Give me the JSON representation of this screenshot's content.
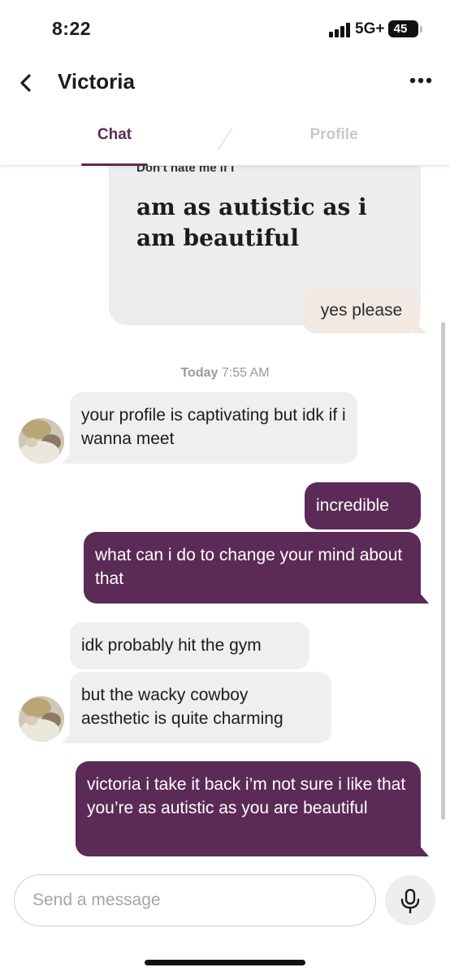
{
  "status_bar": {
    "time": "8:22",
    "network": "5G+",
    "battery": "45"
  },
  "header": {
    "title": "Victoria",
    "back_icon": "chevron-left-icon",
    "more_icon": "ellipsis-icon"
  },
  "tabs": [
    {
      "label": "Chat",
      "active": true
    },
    {
      "label": "Profile",
      "active": false
    }
  ],
  "prompt_card": {
    "question": "Don't hate me if I",
    "answer": "am as autistic as i am beautiful",
    "comment": "yes please"
  },
  "date_separator": {
    "day": "Today",
    "time": "7:55 AM"
  },
  "messages": [
    {
      "from": "Victoria",
      "text": "your profile is captivating but idk if i wanna meet"
    },
    {
      "from": "me",
      "text": "incredible"
    },
    {
      "from": "me",
      "text": "what can i do to change your mind about that"
    },
    {
      "from": "Victoria",
      "text": "idk probably hit the gym"
    },
    {
      "from": "Victoria",
      "text": "but the wacky cowboy aesthetic is quite charming"
    },
    {
      "from": "me",
      "text": "victoria i take it back i’m not sure i like that you’re as autistic as you are beautiful"
    }
  ],
  "composer": {
    "placeholder": "Send a message",
    "mic_icon": "microphone-icon"
  },
  "colors": {
    "accent": "#5c2a57",
    "incoming_bubble": "#efeff1",
    "comment_bubble": "#f2e9e3",
    "card": "#ededef"
  }
}
